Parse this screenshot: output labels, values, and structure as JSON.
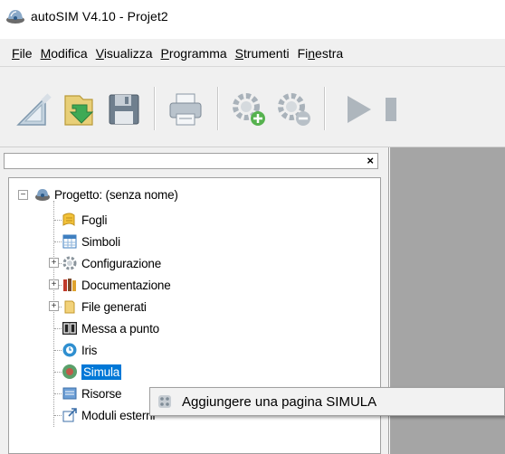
{
  "window": {
    "title": "autoSIM  V4.10 - Projet2"
  },
  "menu": [
    {
      "pre": "",
      "acc": "F",
      "post": "ile"
    },
    {
      "pre": "",
      "acc": "M",
      "post": "odifica"
    },
    {
      "pre": "",
      "acc": "V",
      "post": "isualizza"
    },
    {
      "pre": "",
      "acc": "P",
      "post": "rogramma"
    },
    {
      "pre": "",
      "acc": "S",
      "post": "trumenti"
    },
    {
      "pre": "Fi",
      "acc": "n",
      "post": "estra"
    }
  ],
  "panel": {
    "close_glyph": "×"
  },
  "tree": {
    "root": "Progetto: (senza nome)",
    "items": [
      {
        "label": "Fogli",
        "icon": "sheets-icon"
      },
      {
        "label": "Simboli",
        "icon": "symbols-table-icon"
      },
      {
        "label": "Configurazione",
        "icon": "config-gear-icon",
        "expander": "+"
      },
      {
        "label": "Documentazione",
        "icon": "books-icon",
        "expander": "+"
      },
      {
        "label": "File generati",
        "icon": "folder-icon",
        "expander": "+"
      },
      {
        "label": "Messa a punto",
        "icon": "debug-display-icon"
      },
      {
        "label": "Iris",
        "icon": "iris-icon"
      },
      {
        "label": "Simula",
        "icon": "simulation-icon",
        "selected": true
      },
      {
        "label": "Risorse",
        "icon": "resources-icon"
      },
      {
        "label": "Moduli esterni",
        "icon": "external-modules-icon"
      }
    ]
  },
  "context_menu": {
    "item": "Aggiungere una pagina  SIMULA",
    "icon": "add-page-icon"
  },
  "colors": {
    "selection": "#0078d7",
    "workspace": "#a5a5a5",
    "chrome": "#f0f0f0"
  }
}
